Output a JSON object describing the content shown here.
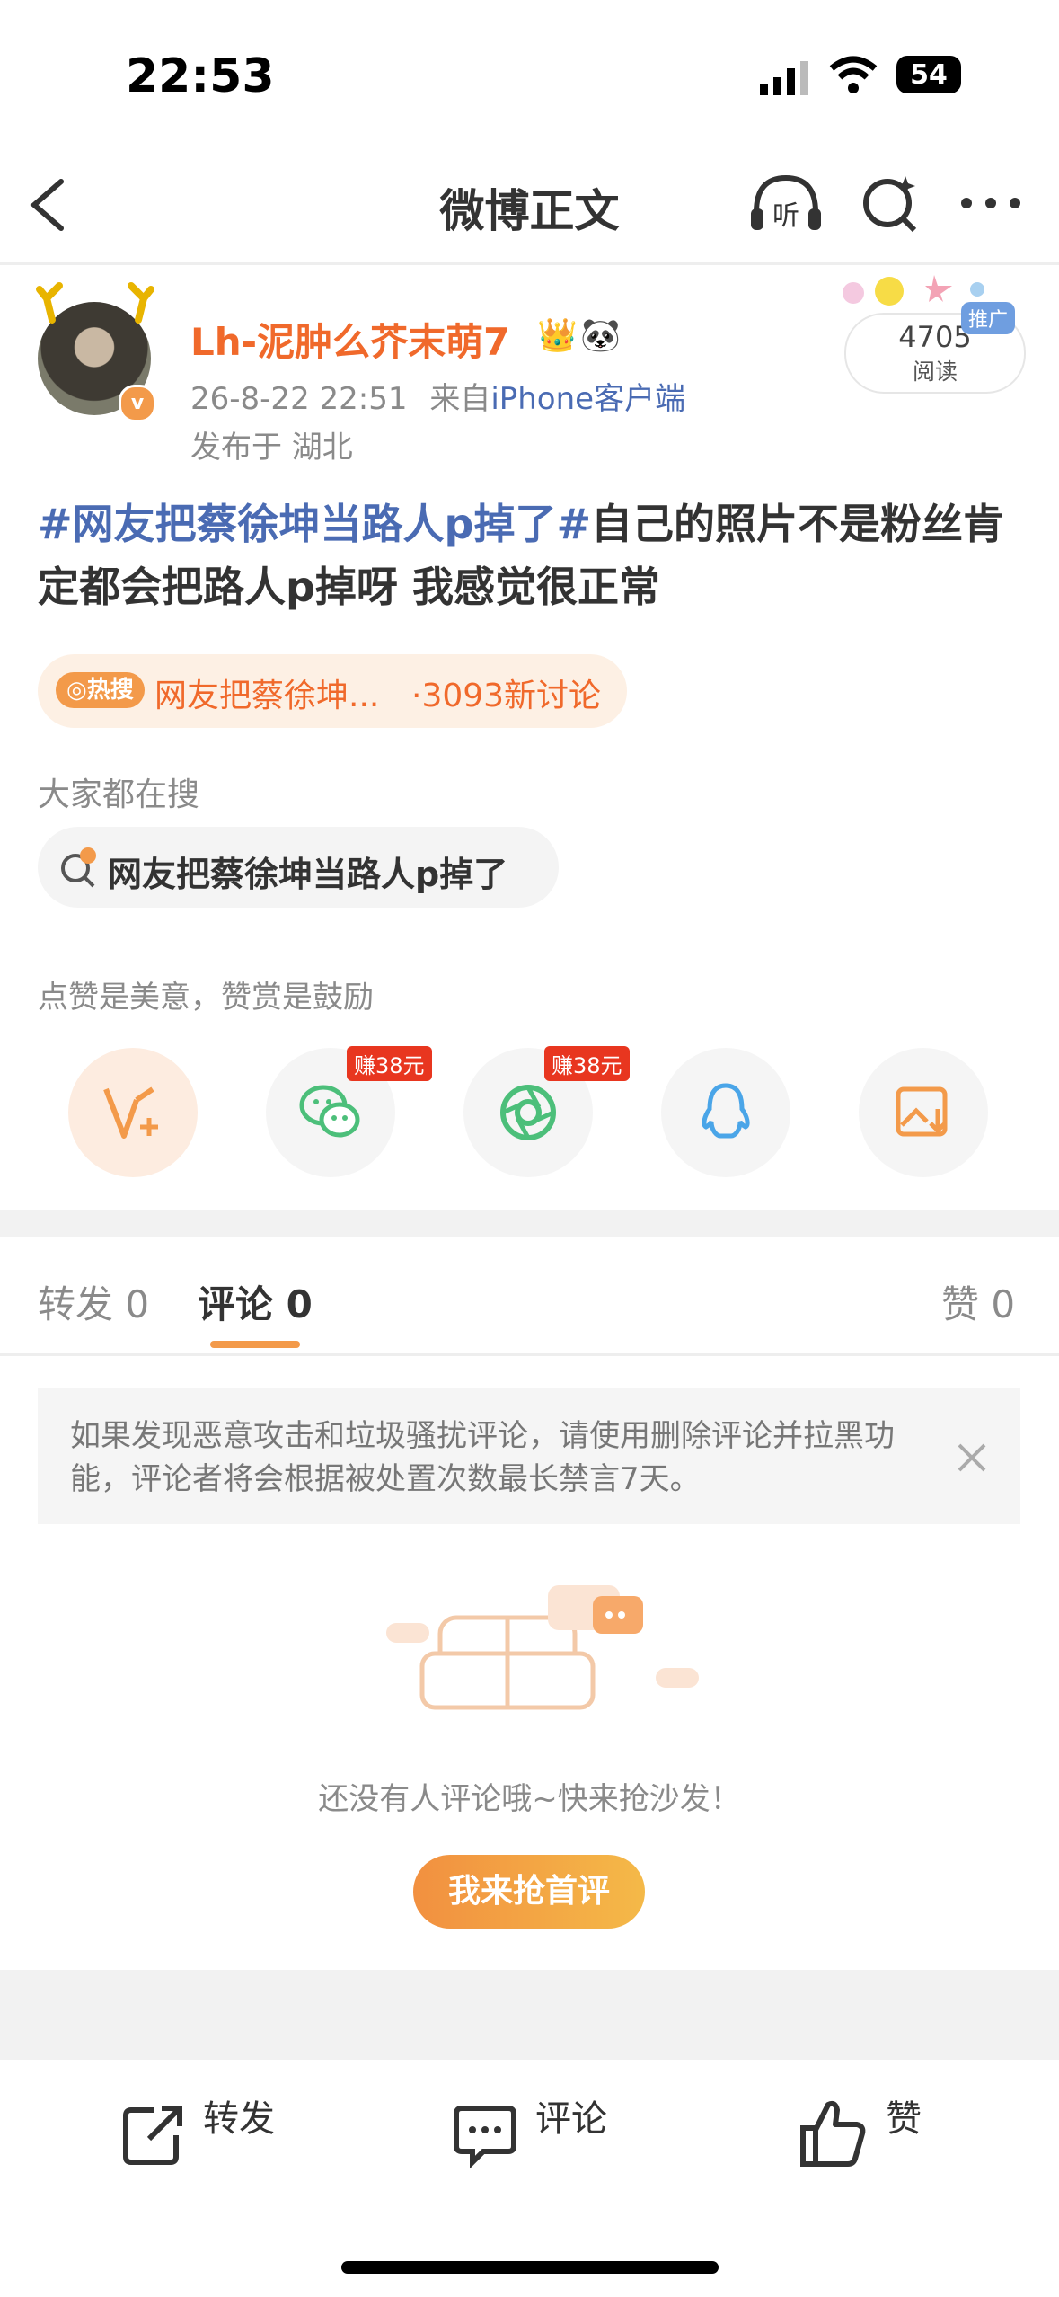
{
  "status_bar": {
    "time": "22:53",
    "battery": "54"
  },
  "nav": {
    "title": "微博正文"
  },
  "author": {
    "name": "Lh-泥肿么芥末萌7",
    "date": "26-8-22 22:51",
    "source_prefix": "来自",
    "source": "iPhone客户端",
    "location": "发布于 湖北"
  },
  "reads": {
    "count": "4705",
    "label": "阅读",
    "promo": "推广"
  },
  "post": {
    "hashtag": "#网友把蔡徐坤当路人p掉了#",
    "text": "自己的照片不是粉丝肯定都会把路人p掉呀 我感觉很正常"
  },
  "hot_search": {
    "badge": "热搜",
    "title": "网友把蔡徐坤...",
    "count": "·3093新讨论"
  },
  "everyone_search": {
    "label": "大家都在搜",
    "query": "网友把蔡徐坤当路人p掉了"
  },
  "reward_tip": "点赞是美意，赞赏是鼓励",
  "share": {
    "earn_wechat": "赚38元",
    "earn_moments": "赚38元"
  },
  "tabs": {
    "repost": "转发 0",
    "comment": "评论 0",
    "like": "赞 0"
  },
  "notice": "如果发现恶意攻击和垃圾骚扰评论，请使用删除评论并拉黑功能，评论者将会根据被处置次数最长禁言7天。",
  "empty": {
    "text": "还没有人评论哦~快来抢沙发！",
    "cta": "我来抢首评"
  },
  "bottom_bar": {
    "repost": "转发",
    "comment": "评论",
    "like": "赞"
  },
  "colors": {
    "accent": "#f0692b",
    "link": "#4a6bb3",
    "orange": "#f39a4a"
  }
}
